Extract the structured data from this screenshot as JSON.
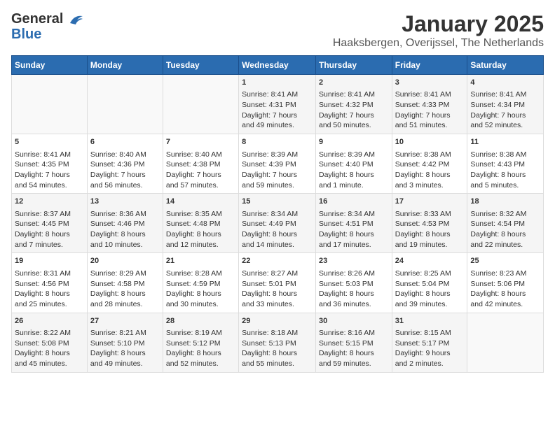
{
  "header": {
    "logo_line1": "General",
    "logo_line2": "Blue",
    "title": "January 2025",
    "subtitle": "Haaksbergen, Overijssel, The Netherlands"
  },
  "days_of_week": [
    "Sunday",
    "Monday",
    "Tuesday",
    "Wednesday",
    "Thursday",
    "Friday",
    "Saturday"
  ],
  "weeks": [
    [
      {
        "day": "",
        "content": ""
      },
      {
        "day": "",
        "content": ""
      },
      {
        "day": "",
        "content": ""
      },
      {
        "day": "1",
        "content": "Sunrise: 8:41 AM\nSunset: 4:31 PM\nDaylight: 7 hours\nand 49 minutes."
      },
      {
        "day": "2",
        "content": "Sunrise: 8:41 AM\nSunset: 4:32 PM\nDaylight: 7 hours\nand 50 minutes."
      },
      {
        "day": "3",
        "content": "Sunrise: 8:41 AM\nSunset: 4:33 PM\nDaylight: 7 hours\nand 51 minutes."
      },
      {
        "day": "4",
        "content": "Sunrise: 8:41 AM\nSunset: 4:34 PM\nDaylight: 7 hours\nand 52 minutes."
      }
    ],
    [
      {
        "day": "5",
        "content": "Sunrise: 8:41 AM\nSunset: 4:35 PM\nDaylight: 7 hours\nand 54 minutes."
      },
      {
        "day": "6",
        "content": "Sunrise: 8:40 AM\nSunset: 4:36 PM\nDaylight: 7 hours\nand 56 minutes."
      },
      {
        "day": "7",
        "content": "Sunrise: 8:40 AM\nSunset: 4:38 PM\nDaylight: 7 hours\nand 57 minutes."
      },
      {
        "day": "8",
        "content": "Sunrise: 8:39 AM\nSunset: 4:39 PM\nDaylight: 7 hours\nand 59 minutes."
      },
      {
        "day": "9",
        "content": "Sunrise: 8:39 AM\nSunset: 4:40 PM\nDaylight: 8 hours\nand 1 minute."
      },
      {
        "day": "10",
        "content": "Sunrise: 8:38 AM\nSunset: 4:42 PM\nDaylight: 8 hours\nand 3 minutes."
      },
      {
        "day": "11",
        "content": "Sunrise: 8:38 AM\nSunset: 4:43 PM\nDaylight: 8 hours\nand 5 minutes."
      }
    ],
    [
      {
        "day": "12",
        "content": "Sunrise: 8:37 AM\nSunset: 4:45 PM\nDaylight: 8 hours\nand 7 minutes."
      },
      {
        "day": "13",
        "content": "Sunrise: 8:36 AM\nSunset: 4:46 PM\nDaylight: 8 hours\nand 10 minutes."
      },
      {
        "day": "14",
        "content": "Sunrise: 8:35 AM\nSunset: 4:48 PM\nDaylight: 8 hours\nand 12 minutes."
      },
      {
        "day": "15",
        "content": "Sunrise: 8:34 AM\nSunset: 4:49 PM\nDaylight: 8 hours\nand 14 minutes."
      },
      {
        "day": "16",
        "content": "Sunrise: 8:34 AM\nSunset: 4:51 PM\nDaylight: 8 hours\nand 17 minutes."
      },
      {
        "day": "17",
        "content": "Sunrise: 8:33 AM\nSunset: 4:53 PM\nDaylight: 8 hours\nand 19 minutes."
      },
      {
        "day": "18",
        "content": "Sunrise: 8:32 AM\nSunset: 4:54 PM\nDaylight: 8 hours\nand 22 minutes."
      }
    ],
    [
      {
        "day": "19",
        "content": "Sunrise: 8:31 AM\nSunset: 4:56 PM\nDaylight: 8 hours\nand 25 minutes."
      },
      {
        "day": "20",
        "content": "Sunrise: 8:29 AM\nSunset: 4:58 PM\nDaylight: 8 hours\nand 28 minutes."
      },
      {
        "day": "21",
        "content": "Sunrise: 8:28 AM\nSunset: 4:59 PM\nDaylight: 8 hours\nand 30 minutes."
      },
      {
        "day": "22",
        "content": "Sunrise: 8:27 AM\nSunset: 5:01 PM\nDaylight: 8 hours\nand 33 minutes."
      },
      {
        "day": "23",
        "content": "Sunrise: 8:26 AM\nSunset: 5:03 PM\nDaylight: 8 hours\nand 36 minutes."
      },
      {
        "day": "24",
        "content": "Sunrise: 8:25 AM\nSunset: 5:04 PM\nDaylight: 8 hours\nand 39 minutes."
      },
      {
        "day": "25",
        "content": "Sunrise: 8:23 AM\nSunset: 5:06 PM\nDaylight: 8 hours\nand 42 minutes."
      }
    ],
    [
      {
        "day": "26",
        "content": "Sunrise: 8:22 AM\nSunset: 5:08 PM\nDaylight: 8 hours\nand 45 minutes."
      },
      {
        "day": "27",
        "content": "Sunrise: 8:21 AM\nSunset: 5:10 PM\nDaylight: 8 hours\nand 49 minutes."
      },
      {
        "day": "28",
        "content": "Sunrise: 8:19 AM\nSunset: 5:12 PM\nDaylight: 8 hours\nand 52 minutes."
      },
      {
        "day": "29",
        "content": "Sunrise: 8:18 AM\nSunset: 5:13 PM\nDaylight: 8 hours\nand 55 minutes."
      },
      {
        "day": "30",
        "content": "Sunrise: 8:16 AM\nSunset: 5:15 PM\nDaylight: 8 hours\nand 59 minutes."
      },
      {
        "day": "31",
        "content": "Sunrise: 8:15 AM\nSunset: 5:17 PM\nDaylight: 9 hours\nand 2 minutes."
      },
      {
        "day": "",
        "content": ""
      }
    ]
  ]
}
